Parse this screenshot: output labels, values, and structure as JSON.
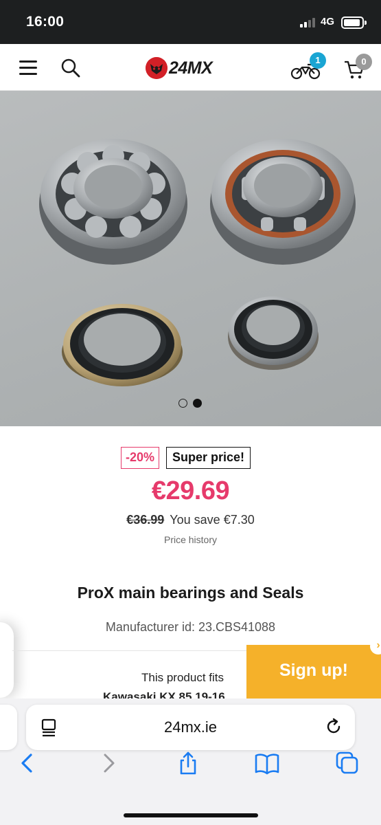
{
  "status_bar": {
    "time": "16:00",
    "network": "4G"
  },
  "header": {
    "logo_text": "24MX",
    "garage_count": "1",
    "cart_count": "0",
    "colors": {
      "badge_blue": "#1aa5d3",
      "badge_grey": "#9a9a9a",
      "logo_red": "#d22027"
    }
  },
  "gallery": {
    "total_images": 2,
    "active_index": 2,
    "icons": [
      "menu-icon",
      "search-icon",
      "motorcycle-icon",
      "cart-icon"
    ]
  },
  "product": {
    "discount_badge": "-20%",
    "promo_badge": "Super price!",
    "price": "€29.69",
    "old_price": "€36.99",
    "savings": "You save €7.30",
    "price_history_link": "Price history",
    "title": "ProX main bearings and Seals",
    "manufacturer_id": "Manufacturer id: 23.CBS41088",
    "fits_label": "This product fits",
    "fits_model": "Kawasaki KX 85 19-16",
    "colors": {
      "price_pink": "#e63a6b"
    }
  },
  "signup_banner": {
    "label": "Sign up!",
    "close_symbol": "›",
    "color": "#f5b12a"
  },
  "browser": {
    "url": "24mx.ie",
    "toolbar_icons": [
      "back-icon",
      "forward-icon",
      "share-icon",
      "bookmarks-icon",
      "tabs-icon"
    ]
  }
}
